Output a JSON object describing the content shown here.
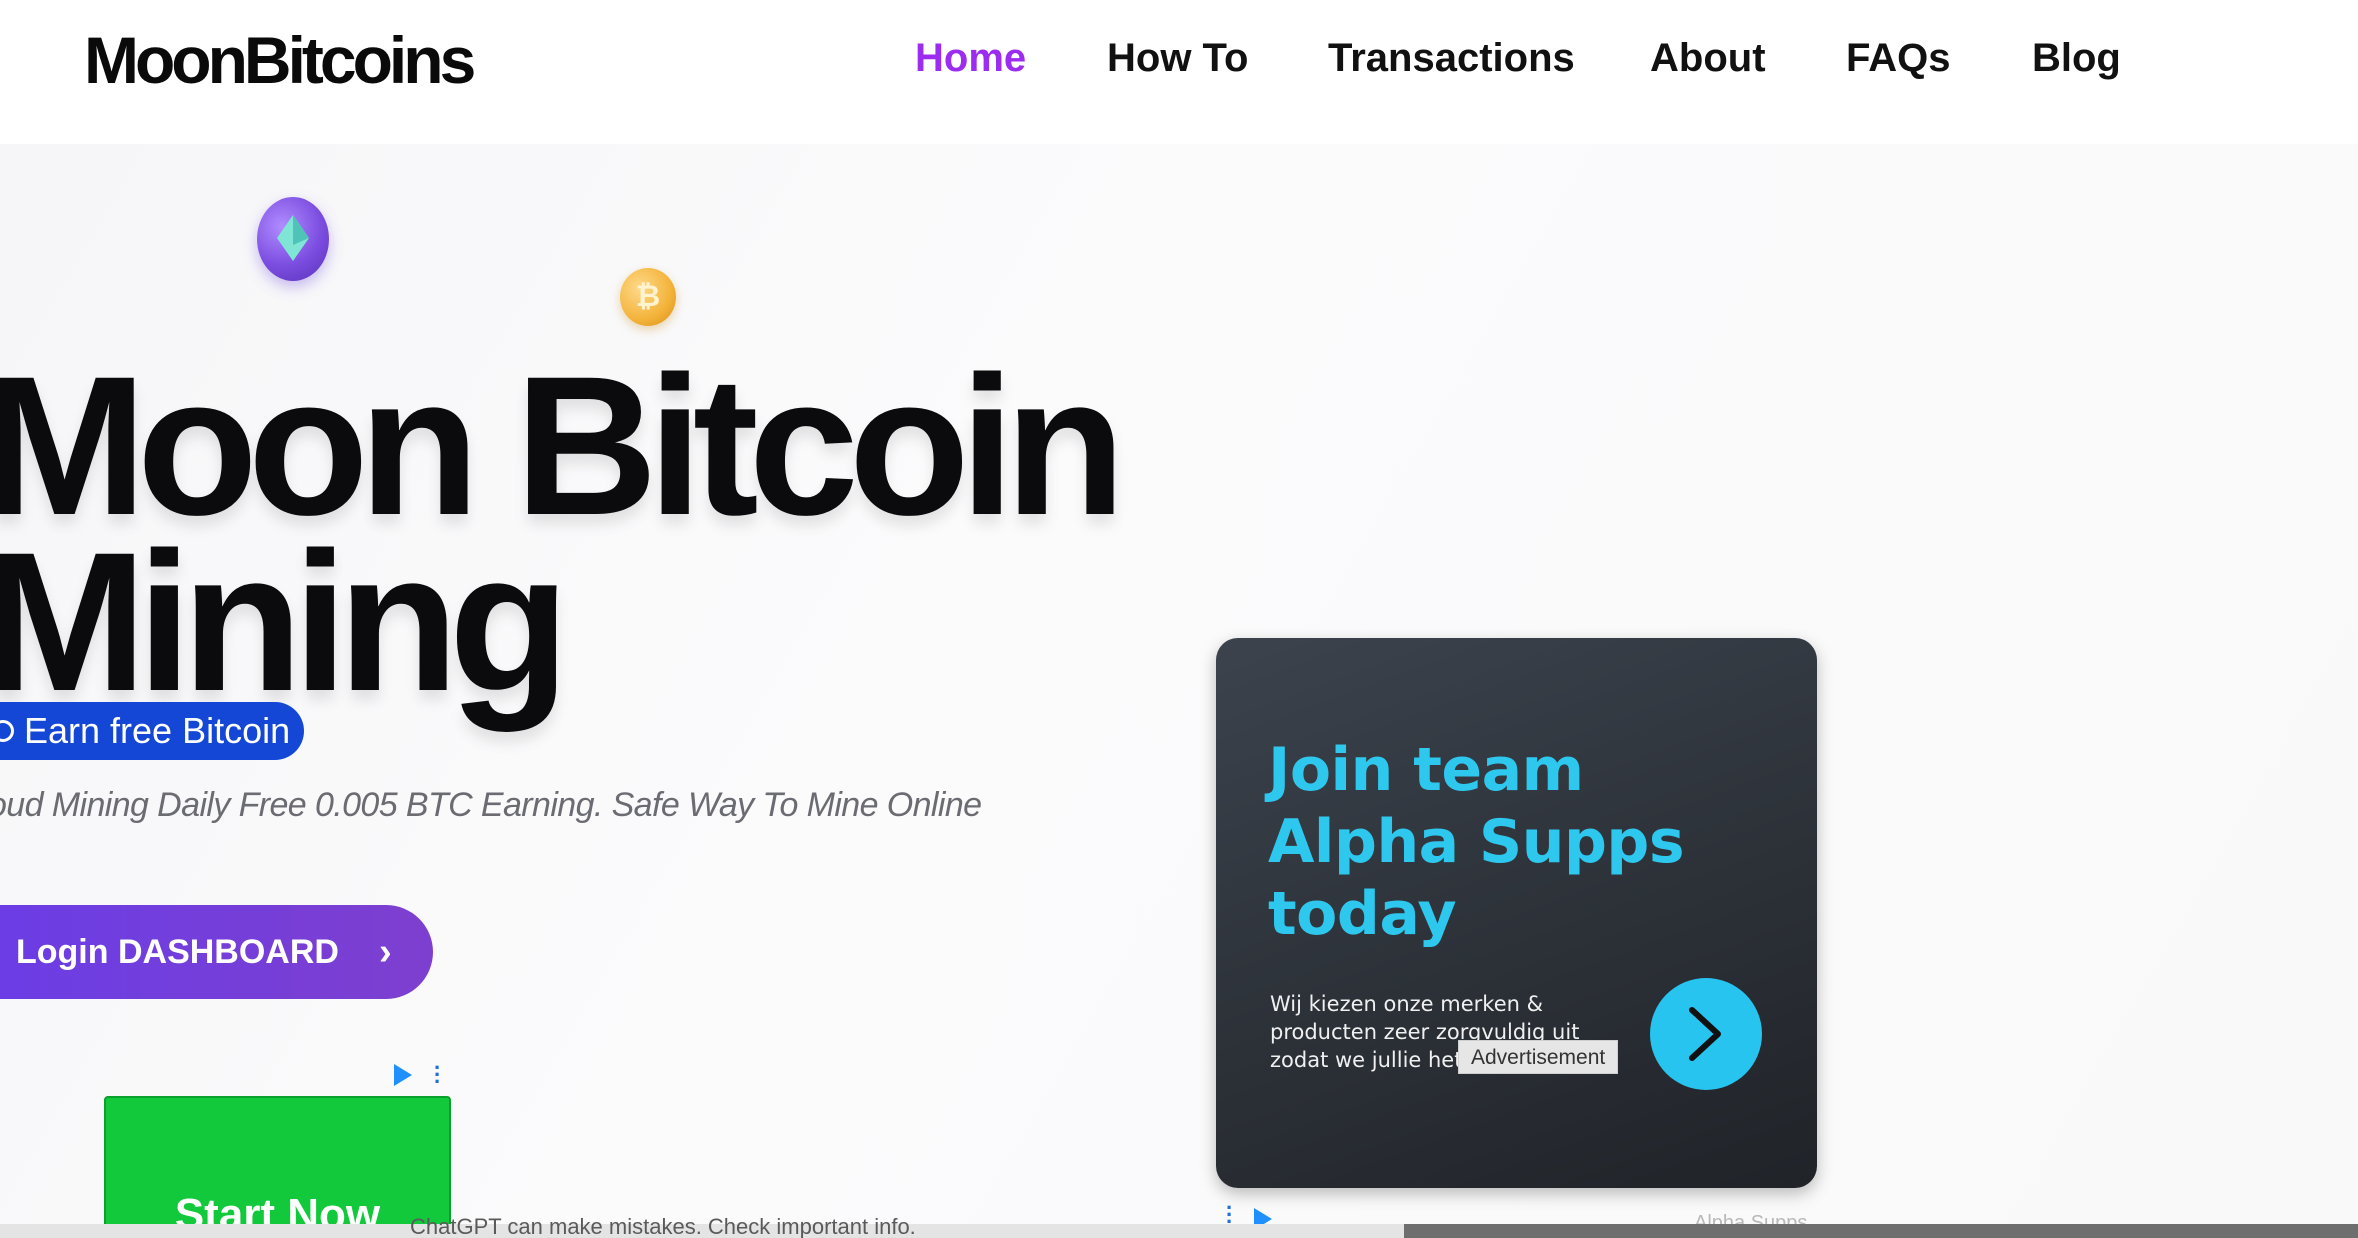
{
  "header": {
    "logo": "MoonBitcoins",
    "nav": [
      {
        "label": "Home",
        "active": true
      },
      {
        "label": "How To",
        "active": false
      },
      {
        "label": "Transactions",
        "active": false
      },
      {
        "label": "About",
        "active": false
      },
      {
        "label": "FAQs",
        "active": false
      },
      {
        "label": "Blog",
        "active": false
      }
    ],
    "active_color": "#9b2cf0"
  },
  "hero": {
    "title_line1": "Moon Bitcoin",
    "title_line2": "Mining",
    "badge": "Earn free Bitcoin",
    "subtitle": "oud Mining Daily Free 0.005 BTC Earning. Safe Way To Mine Online",
    "login_button": "Login DASHBOARD",
    "login_chevron": "›",
    "coin_icons": [
      "ethereum-coin-icon",
      "bitcoin-coin-icon"
    ],
    "bitcoin_glyph": "₿"
  },
  "ad_left": {
    "button": "Start Now"
  },
  "ad_right": {
    "headline": "Join team Alpha Supps today",
    "body": "Wij kiezen onze merken & producten zeer zorgvuldig uit zodat we jullie het",
    "label": "Advertisement",
    "sponsor": "Alpha Supps",
    "accent": "#2ec8ef"
  },
  "footer_overlay": {
    "disclaimer": "ChatGPT can make mistakes. Check important info."
  }
}
